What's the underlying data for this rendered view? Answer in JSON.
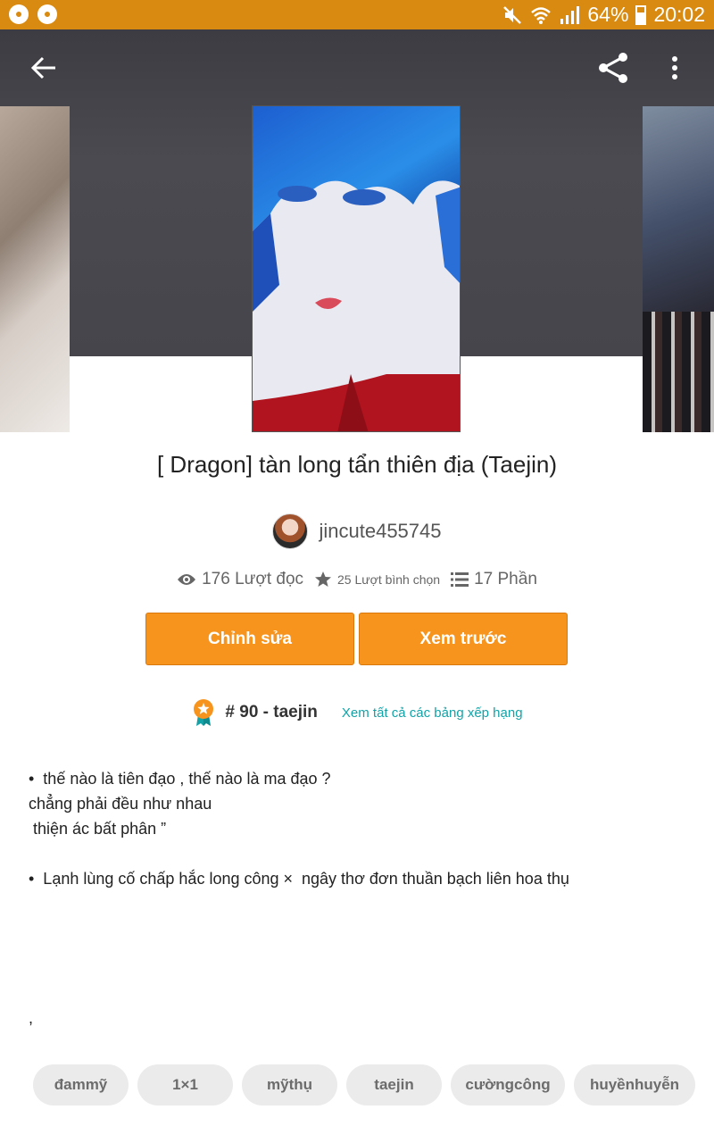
{
  "status_bar": {
    "battery": "64%",
    "time": "20:02",
    "left_icons": [
      "chrome-icon",
      "chrome-icon"
    ],
    "right_icons": [
      "mute-icon",
      "wifi-icon",
      "signal-icon",
      "battery-icon"
    ]
  },
  "toolbar": {
    "back_icon": "arrow-left-icon",
    "share_icon": "share-icon",
    "more_icon": "more-vert-icon"
  },
  "story": {
    "title": "[ Dragon] tàn long tẩn thiên địa (Taejin)",
    "author": "jincute455745",
    "stats": {
      "reads": "176 Lượt đọc",
      "votes": "25 Lượt bình chọn",
      "parts": "17 Phần"
    }
  },
  "actions": {
    "edit_label": "Chỉnh sửa",
    "preview_label": "Xem trước"
  },
  "ranking": {
    "label": "# 90 - taejin",
    "link": "Xem tất cả các bảng xếp hạng"
  },
  "description": {
    "line1": "•  thế nào là tiên đạo , thế nào là ma đạo ?",
    "line2": "chẳng phải đều như nhau",
    "line3": " thiện ác bất phân ”",
    "line4": "",
    "line5": "•  Lạnh lùng cố chấp hắc long công ×  ngây thơ đơn thuần bạch liên hoa thụ",
    "trailing": ","
  },
  "tags": [
    "đammỹ",
    "1×1",
    "mỹthụ",
    "taejin",
    "cườngcông",
    "huyềnhuyễn"
  ],
  "colors": {
    "status_bar": "#d98a10",
    "accent_button": "#f7941d",
    "link": "#12a3a8",
    "tag_bg": "#ebebeb"
  }
}
